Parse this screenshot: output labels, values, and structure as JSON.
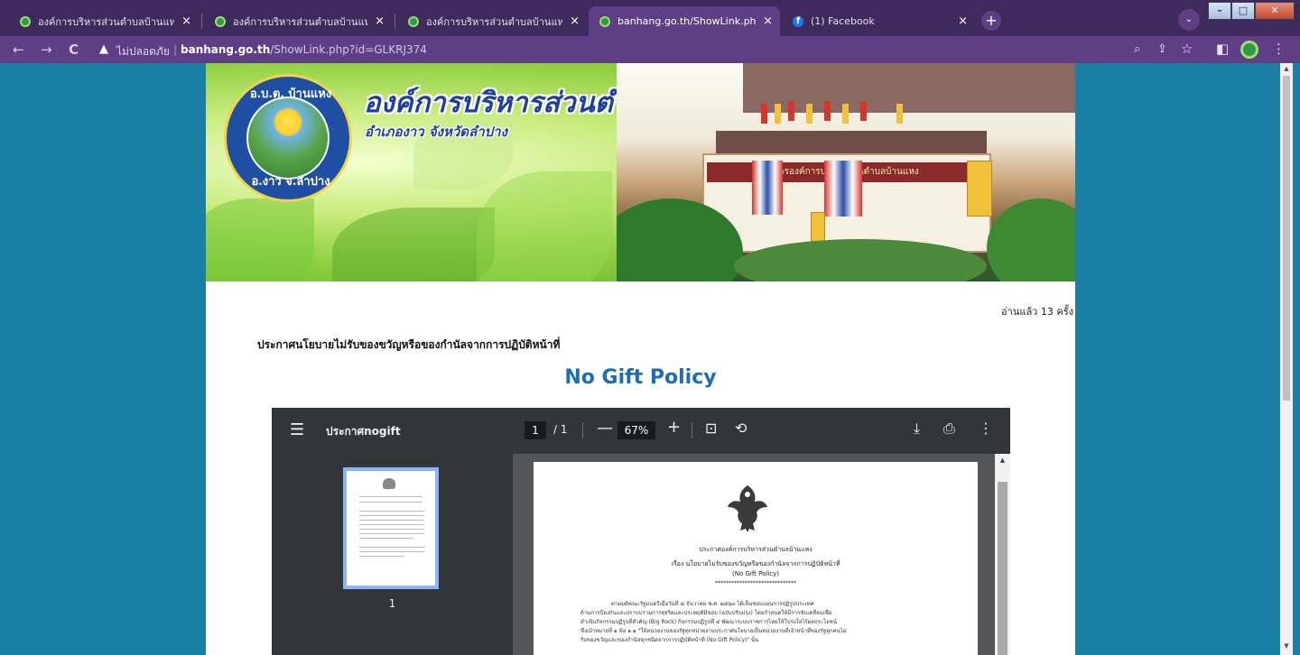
{
  "browser": {
    "tabs": [
      {
        "title": "องค์การบริหารส่วนตำบลบ้านแหง อำเภ",
        "close": "×",
        "icon": "site-favicon",
        "active": false
      },
      {
        "title": "องค์การบริหารส่วนตำบลบ้านแหง อำเภ",
        "close": "×",
        "icon": "site-favicon",
        "active": false
      },
      {
        "title": "องค์การบริหารส่วนตำบลบ้านแหง อำเภ",
        "close": "×",
        "icon": "site-favicon",
        "active": false
      },
      {
        "title": "banhang.go.th/ShowLink.php?id",
        "close": "×",
        "icon": "site-favicon",
        "active": true
      },
      {
        "title": "(1) Facebook",
        "close": "×",
        "icon": "facebook-favicon",
        "active": false
      }
    ],
    "new_tab": "+",
    "tab_search": "⌄",
    "window": {
      "minimize": "–",
      "maximize": "□",
      "close": "✕"
    },
    "toolbar": {
      "back": "←",
      "forward": "→",
      "reload": "C",
      "warning_icon": "▲",
      "insecure_label": "ไม่ปลอดภัย",
      "separator": "|",
      "url_host": "banhang.go.th",
      "url_path": "/ShowLink.php?id=GLKRJ374",
      "zoom_icon": "⌕",
      "share_icon": "⇪",
      "bookmark_icon": "☆",
      "sidepanel_icon": "◧",
      "menu_icon": "⋮"
    }
  },
  "site": {
    "banner": {
      "title": "องค์การบริหารส่วนตำบลบ้านแหง",
      "subtitle": "อำเภองาว จังหวัดลำปาง",
      "seal_top": "อ.บ.ต. บ้านแหง",
      "seal_bottom": "อ.งาว จ.ลำปาง",
      "building_sign": "ที่ทำการองค์การบริหารส่วนตำบลบ้านแหง"
    },
    "read_count": "อ่านแล้ว 13 ครั้ง",
    "post_title": "ประกาศนโยบายไม่รับของขวัญหรือของกำนัลจากการปฏิบัติหน้าที่",
    "policy_heading": "No Gift Policy"
  },
  "pdf": {
    "menu_icon": "☰",
    "file_name": "ประกาศnogift",
    "page_current": "1",
    "page_total": "/ 1",
    "zoom_out": "—",
    "zoom_value": "67%",
    "zoom_in": "+",
    "fit_icon": "⊡",
    "rotate_icon": "⟲",
    "download_icon": "⤓",
    "print_icon": "⎙",
    "more_icon": "⋮",
    "thumbnail_label": "1",
    "doc": {
      "line1": "ประกาศองค์การบริหารส่วนตำบลบ้านแหง",
      "line2": "เรื่อง  นโยบายไม่รับของขวัญหรือของกำนัลจากการปฏิบัติหน้าที่",
      "line3": "(No Gift Policy)",
      "line4": "******************************",
      "para1": "ตามมติคณะรัฐมนตรีเมื่อวันที่ ๘ ธันวาคม พ.ศ. ๒๕๖๓ ได้เห็นชอบแผนการปฏิรูปประเทศ",
      "para2": "ด้านการป้องกันและปราบปรามการทุจริตและประพฤติมิชอบ (ฉบับปรับปรุง) โดยกำหนดให้มีการขับเคลื่อนเพื่อ",
      "para3": "ดำเนินกิจกรรมปฏิรูปที่สำคัญ (Big Rock) กิจกรรมปฏิรูปที่ ๔ พัฒนาระบบราชการไทยให้โปร่งใสไร้ผลประโยชน์",
      "para4": "ซึ่งเป้าหมายที่ ๑ ข้อ ๑.๑ \"ให้หน่วยงานของรัฐทุกหน่วยงานประกาศนโยบายเป็นหน่วยงานที่เจ้าหน้าที่ของรัฐทุกคนไม่",
      "para5": "รับของขวัญและของกำนัลทุกชนิดจากการปฏิบัติหน้าที่ (No Gift Policy)\" นั้น"
    }
  }
}
